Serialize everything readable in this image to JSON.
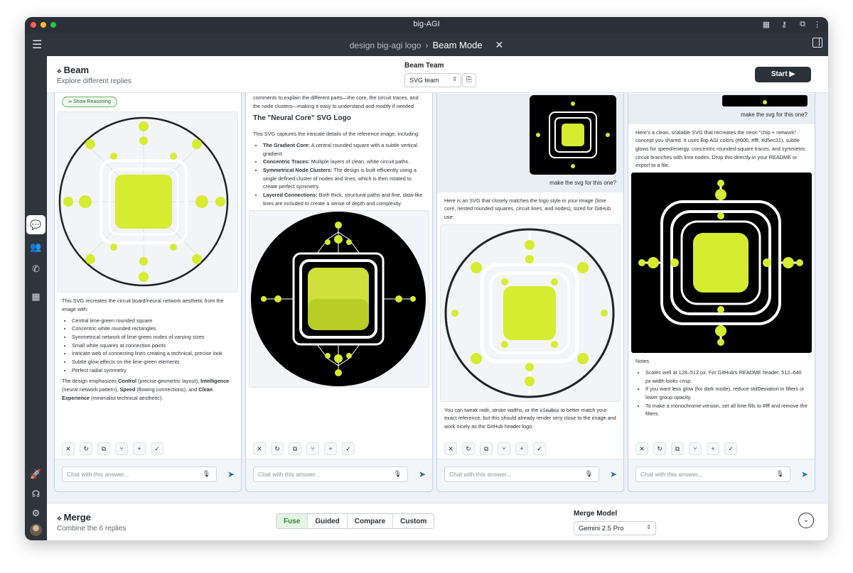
{
  "window": {
    "title": "big-AGI"
  },
  "topbar": {
    "breadcrumb_parent": "design big-agi logo",
    "breadcrumb_sep": "›",
    "breadcrumb_current": "Beam Mode",
    "close": "✕"
  },
  "beam": {
    "title": "Beam",
    "subtitle": "Explore different replies",
    "team_label": "Beam Team",
    "team_value": "SVG team",
    "start_label": "Start"
  },
  "columns": [
    {
      "reasoning_label": "Show Reasoning",
      "intro": "This SVG recreates the circuit board/neural network aesthetic from the image with:",
      "bullets": [
        "Central lime-green rounded square",
        "Concentric white rounded rectangles",
        "Symmetrical network of lime-green nodes of varying sizes",
        "Small white squares at connection points",
        "Intricate web of connecting lines creating a technical, precise look",
        "Subtle glow effects on the lime-green elements",
        "Perfect radial symmetry"
      ],
      "closing": {
        "pre": "The design emphasizes ",
        "b1": "Control",
        "t1": " (precise geometric layout), ",
        "b2": "Intelligence",
        "t2": " (neural network pattern), ",
        "b3": "Speed",
        "t3": " (flowing connections), and ",
        "b4": "Clean Experience",
        "t4": " (minimalist technical aesthetic)."
      }
    },
    {
      "intro": "comments to explain the different parts—the core, the circuit traces, and the node clusters—making it easy to understand and modify if needed.",
      "heading": "The \"Neural Core\" SVG Logo",
      "lead": "This SVG captures the intricate details of the reference image, including:",
      "bullets": [
        {
          "b": "The Gradient Core:",
          "t": " A central rounded square with a subtle vertical gradient."
        },
        {
          "b": "Concentric Traces:",
          "t": " Multiple layers of clean, white circuit paths."
        },
        {
          "b": "Symmetrical Node Clusters:",
          "t": " The design is built efficiently using a single defined cluster of nodes and lines, which is then rotated to create perfect symmetry."
        },
        {
          "b": "Layered Connections:",
          "t": " Both thick, structural paths and fine, data-like lines are included to create a sense of depth and complexity."
        }
      ]
    },
    {
      "user_msg": "make the svg for this one?",
      "intro": "Here is an SVG that closely matches the logo style in your image (lime core, nested rounded squares, circuit lines, and nodes), sized for GitHub use:",
      "closing_pre": "You can tweak radii, stroke widths, or the ",
      "closing_code": "viewBox",
      "closing_post": " to better match your exact reference, but this should already render very close to the image and work nicely as the GitHub header logo."
    },
    {
      "user_msg": "make the svg for this one?",
      "intro": "Here's a clean, scalable SVG that recreates the neon \"chip + network\" concept you shared. It uses Big-AGI colors (#000, #fff, #d5ec31), subtle glows for speed/energy, concentric rounded-square traces, and symmetric circuit branches with lime nodes. Drop this directly in your README or export to a file.",
      "notes_label": "Notes",
      "bullets": [
        "Scales well at 128–512 px. For GitHub's README header, 512–640 px width looks crisp.",
        "If you want less glow (for dark mode), reduce stdDeviation in filters or lower group opacity.",
        "To make a monochrome version, set all lime fills to #fff and remove the filters."
      ]
    }
  ],
  "chat_placeholder": "Chat with this answer...",
  "merge": {
    "title": "Merge",
    "subtitle": "Combine the 6 replies",
    "tabs": [
      "Fuse",
      "Guided",
      "Compare",
      "Custom"
    ],
    "model_label": "Merge Model",
    "model_value": "Gemini 2.5 Pro"
  },
  "colors": {
    "lime": "#d5ec31",
    "dark": "#2f353d",
    "accent": "#2b6cb0"
  }
}
